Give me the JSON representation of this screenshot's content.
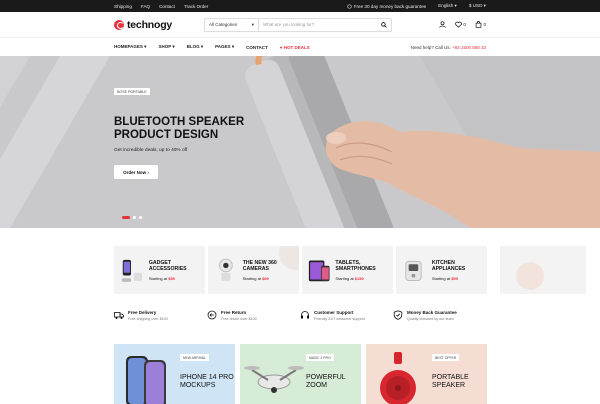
{
  "topbar": {
    "links": [
      "Shipping",
      "FAQ",
      "Contact",
      "Track Order"
    ],
    "promo": "Free 30 day money back guarantee",
    "language": "English",
    "currency": "$ USD"
  },
  "header": {
    "logo_text": "technogy",
    "search": {
      "category": "All Categories",
      "placeholder": "What are you looking for?"
    },
    "wishlist_count": "0",
    "cart_count": "0"
  },
  "nav": {
    "items": [
      "HOMEPAGES",
      "SHOP",
      "BLOG",
      "PAGES",
      "CONTACT"
    ],
    "hot": "HOT DEALS",
    "help_label": "Need help? Call Us:",
    "help_phone": "+84 2500 888 33"
  },
  "hero": {
    "badge": "BOSE PORTABLE",
    "title": "BLUETOOTH SPEAKER PRODUCT DESIGN",
    "subtitle": "Get incredible deals, up to 40% off",
    "cta": "Order Now",
    "slides": 3,
    "active_slide": 1
  },
  "categories": [
    {
      "title": "GADGET ACCESSORIES",
      "starting": "Starting at",
      "price": "$59",
      "icon": "gadget-icon"
    },
    {
      "title": "THE NEW 360 CAMERAS",
      "starting": "Starting at",
      "price": "$99",
      "icon": "camera-icon"
    },
    {
      "title": "TABLETS, SMARTPHONES",
      "starting": "Starting at",
      "price": "$150",
      "icon": "tablet-icon"
    },
    {
      "title": "KITCHEN APPLIANCES",
      "starting": "Starting at",
      "price": "$99",
      "icon": "kitchen-icon"
    }
  ],
  "features": [
    {
      "title": "Free Delivery",
      "sub": "Free shipping over $100"
    },
    {
      "title": "Free Return",
      "sub": "Free return over $100"
    },
    {
      "title": "Customer Support",
      "sub": "Friendly 24/7 customer support"
    },
    {
      "title": "Money Back Guarantee",
      "sub": "Quality checked by our team"
    }
  ],
  "promos": [
    {
      "tag": "NEW ARRIVAL",
      "title": "IPHONE 14 PRO MOCKUPS"
    },
    {
      "tag": "MAVIC 2 PRO",
      "title": "POWERFUL ZOOM"
    },
    {
      "tag": "BEST OFFER",
      "title": "PORTABLE SPEAKER"
    }
  ],
  "colors": {
    "accent": "#e8323e",
    "topbar": "#1a1a1a",
    "hero_bg": "#c9c9cb"
  }
}
